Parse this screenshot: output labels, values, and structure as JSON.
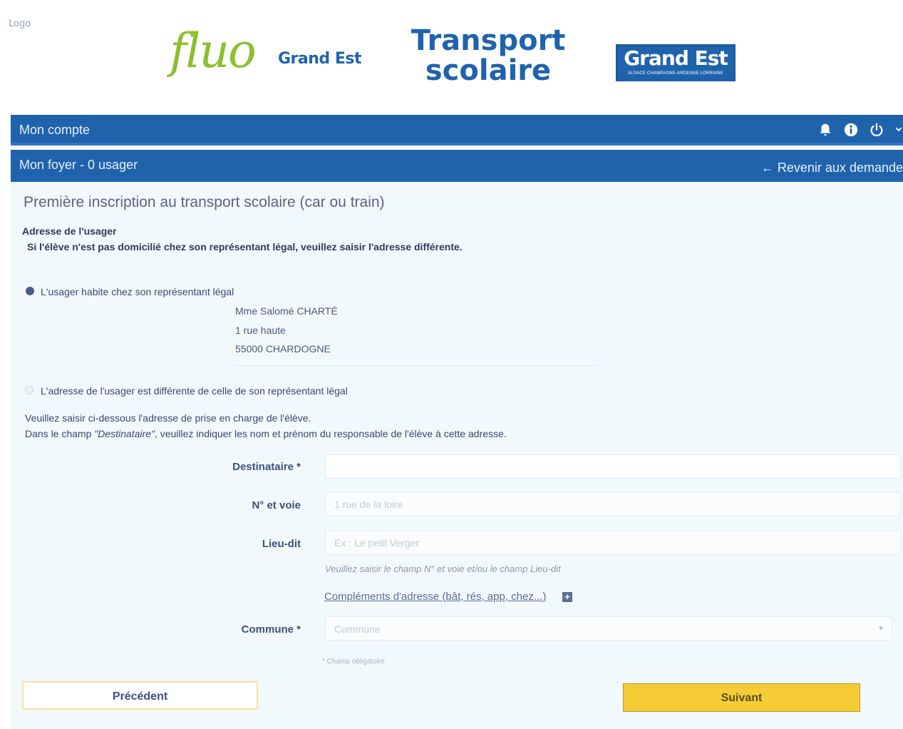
{
  "header": {
    "logo_alt": "Logo",
    "fluo_word": "fluo",
    "fluo_sub": "Grand Est",
    "transport_line1": "Transport",
    "transport_line2": "scolaire",
    "grandest_main": "Grand Est",
    "grandest_sub": "ALSACE CHAMPAGNE-ARDENNE LORRAINE"
  },
  "account_bar": {
    "title": "Mon compte",
    "icons": [
      "bell-icon",
      "info-icon",
      "power-icon",
      "chevron-down-icon"
    ]
  },
  "household_bar": {
    "title": "Mon foyer - 0 usager",
    "back_label": "← Revenir aux demande"
  },
  "page": {
    "title": "Première inscription au transport scolaire (car ou train)",
    "section_title": "Adresse de l'usager",
    "section_note": "Si l'élève n'est pas domicilié chez son représentant légal, veuillez saisir l'adresse différente."
  },
  "options": {
    "same_address_label": "L'usager habite chez son représentant légal",
    "same_address_selected": true,
    "different_address_label": "L'adresse de l'usager est différente de celle de son représentant légal",
    "different_address_selected": false
  },
  "legal_address": {
    "line1": "Mme Salomé CHARTÉ",
    "line2": "1 rue haute",
    "line3": "55000 CHARDOGNE"
  },
  "instructions": {
    "line1": "Veuillez saisir ci-dessous l'adresse de prise en charge de l'élève.",
    "line2_before": "Dans le champ ",
    "line2_italic": "\"Destinataire\"",
    "line2_after": ", veuillez indiquer les nom et prénom du responsable de l'élève à cette adresse."
  },
  "form": {
    "destinataire_label": "Destinataire *",
    "destinataire_value": "",
    "voie_label": "N° et voie",
    "voie_placeholder": "1 rue de la loire",
    "lieu_label": "Lieu-dit",
    "lieu_placeholder": "Ex : Le petit Verger",
    "hint": "Veuillez saisir le champ N° et voie et/ou le champ Lieu-dit",
    "complements_link": "Compléments d'adresse (bât, rés, app, chez...)",
    "commune_label": "Commune *",
    "commune_placeholder": "Commune",
    "required_note": "* Champ obligatoire"
  },
  "buttons": {
    "previous": "Précédent",
    "next": "Suivant"
  },
  "colors": {
    "primary_blue": "#1f63ad",
    "fluo_green": "#8cbf2f",
    "next_yellow": "#f6cc36",
    "content_bg": "#f2f9fd"
  }
}
